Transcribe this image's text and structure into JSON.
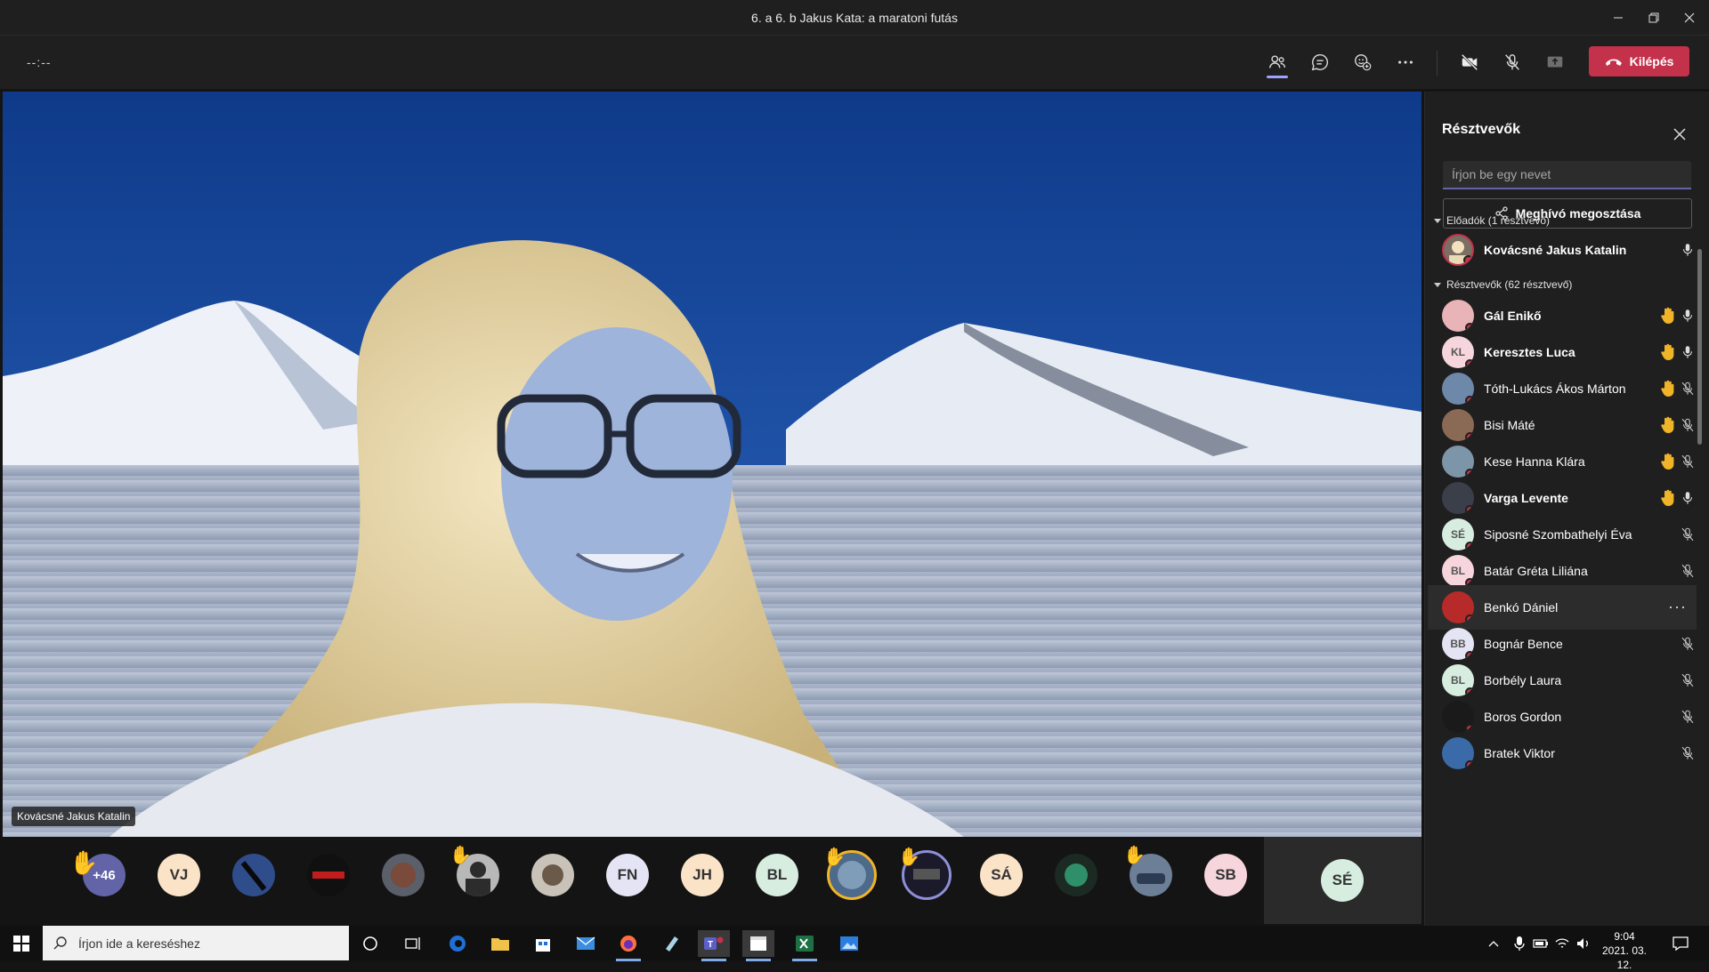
{
  "window": {
    "title": "6. a 6. b Jakus Kata: a maratoni futás"
  },
  "toolbar": {
    "timer": "--:--",
    "leave_label": "Kilépés"
  },
  "stage": {
    "speaker_name": "Kovácsné Jakus Katalin"
  },
  "strip": {
    "overflow": "+46",
    "initials": [
      "VJ",
      "FN",
      "JH",
      "BL",
      "SÁ",
      "SB",
      "SÉ"
    ]
  },
  "panel": {
    "title": "Résztvevők",
    "search_placeholder": "Írjon be egy nevet",
    "invite_label": "Meghívó megosztása",
    "presenters_header": "Előadók (1 résztvevő)",
    "attendees_header": "Résztvevők (62 résztvevő)",
    "presenters": [
      {
        "name": "Kovácsné Jakus Katalin",
        "mic": "on",
        "hand": false
      }
    ],
    "attendees": [
      {
        "name": "Gál Enikő",
        "mic": "on",
        "hand": true
      },
      {
        "name": "Keresztes Luca",
        "initials": "KL",
        "mic": "on",
        "hand": true
      },
      {
        "name": "Tóth-Lukács Ákos Márton",
        "mic": "off",
        "hand": true
      },
      {
        "name": "Bisi Máté",
        "mic": "off",
        "hand": true
      },
      {
        "name": "Kese Hanna Klára",
        "mic": "off",
        "hand": true
      },
      {
        "name": "Varga Levente",
        "mic": "on",
        "hand": true
      },
      {
        "name": "Siposné Szombathelyi Éva",
        "initials": "SÉ",
        "mic": "off",
        "hand": false
      },
      {
        "name": "Batár Gréta Liliána",
        "initials": "BL",
        "mic": "off",
        "hand": false
      },
      {
        "name": "Benkó Dániel",
        "mic": "more",
        "hand": false
      },
      {
        "name": "Bognár Bence",
        "initials": "BB",
        "mic": "off",
        "hand": false
      },
      {
        "name": "Borbély Laura",
        "initials": "BL",
        "mic": "off",
        "hand": false
      },
      {
        "name": "Boros Gordon",
        "mic": "off",
        "hand": false
      },
      {
        "name": "Bratek Viktor",
        "mic": "off",
        "hand": false
      }
    ]
  },
  "taskbar": {
    "search_placeholder": "Írjon ide a kereséshez",
    "time": "9:04",
    "date": "2021. 03. 12."
  },
  "colors": {
    "accent": "#6264a7",
    "leave": "#c4314b",
    "hand": "#f0b429"
  }
}
